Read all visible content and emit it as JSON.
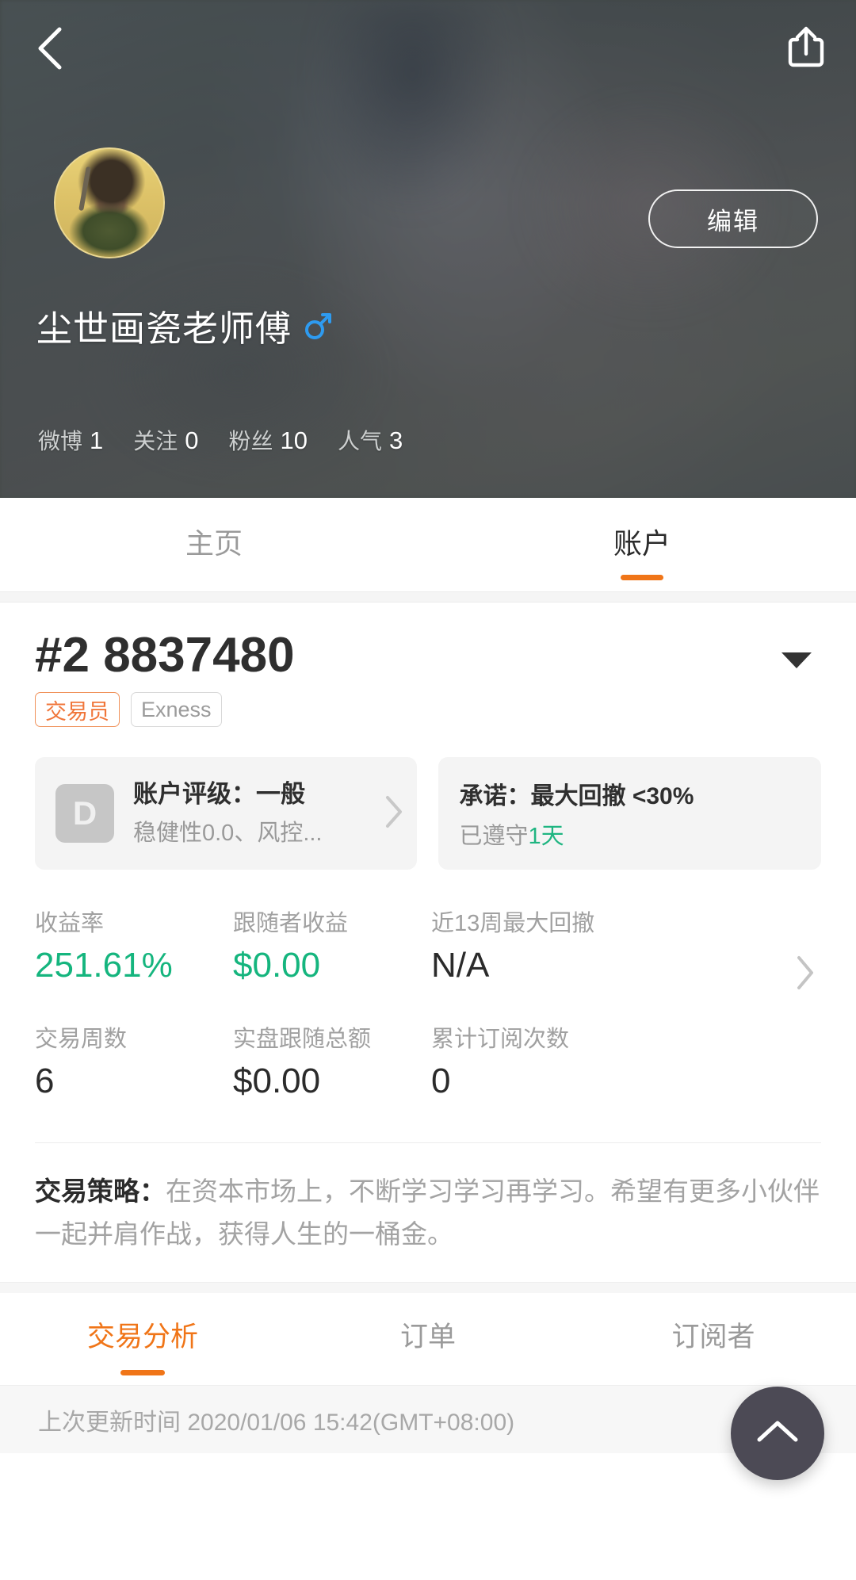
{
  "header": {
    "back_icon": "chevron-left-icon",
    "share_icon": "share-upload-icon",
    "edit_button": "编辑",
    "profile_name": "尘世画瓷老师傅",
    "gender_icon": "male-gender-icon",
    "stats": [
      {
        "label": "微博",
        "value": "1"
      },
      {
        "label": "关注",
        "value": "0"
      },
      {
        "label": "粉丝",
        "value": "10"
      },
      {
        "label": "人气",
        "value": "3"
      }
    ]
  },
  "top_tabs": [
    {
      "label": "主页",
      "active": false
    },
    {
      "label": "账户",
      "active": true
    }
  ],
  "account": {
    "number": "#2 8837480",
    "caret_icon": "caret-down-icon",
    "badges": [
      {
        "label": "交易员",
        "type": "trader"
      },
      {
        "label": "Exness",
        "type": "broker"
      }
    ]
  },
  "rating_card": {
    "grade": "D",
    "title": "账户评级：一般",
    "subtitle": "稳健性0.0、风控...",
    "chevron_icon": "chevron-right-icon"
  },
  "promise_card": {
    "title": "承诺：最大回撤 <30%",
    "prefix": "已遵守",
    "days": "1天"
  },
  "stats_grid": {
    "arrow_icon": "chevron-right-icon",
    "rows": [
      [
        {
          "label": "收益率",
          "value": "251.61%",
          "color": "green"
        },
        {
          "label": "跟随者收益",
          "value": "$0.00",
          "color": "green"
        },
        {
          "label": "近13周最大回撤",
          "value": "N/A",
          "color": "dark"
        }
      ],
      [
        {
          "label": "交易周数",
          "value": "6",
          "color": "dark"
        },
        {
          "label": "实盘跟随总额",
          "value": "$0.00",
          "color": "dark"
        },
        {
          "label": "累计订阅次数",
          "value": "0",
          "color": "dark"
        }
      ]
    ]
  },
  "strategy": {
    "label": "交易策略：",
    "text": "在资本市场上，不断学习学习再学习。希望有更多小伙伴一起并肩作战，获得人生的一桶金。"
  },
  "bottom_tabs": [
    {
      "label": "交易分析",
      "active": true
    },
    {
      "label": "订单",
      "active": false
    },
    {
      "label": "订阅者",
      "active": false
    }
  ],
  "update_bar": {
    "text": "上次更新时间 2020/01/06 15:42(GMT+08:00)"
  },
  "fab": {
    "icon": "chevron-up-icon"
  },
  "colors": {
    "accent_orange": "#f07518",
    "green": "#15b57e",
    "trader_badge": "#f0763a",
    "dark_text": "#2b2b2b",
    "muted_text": "#a0a0a0"
  }
}
